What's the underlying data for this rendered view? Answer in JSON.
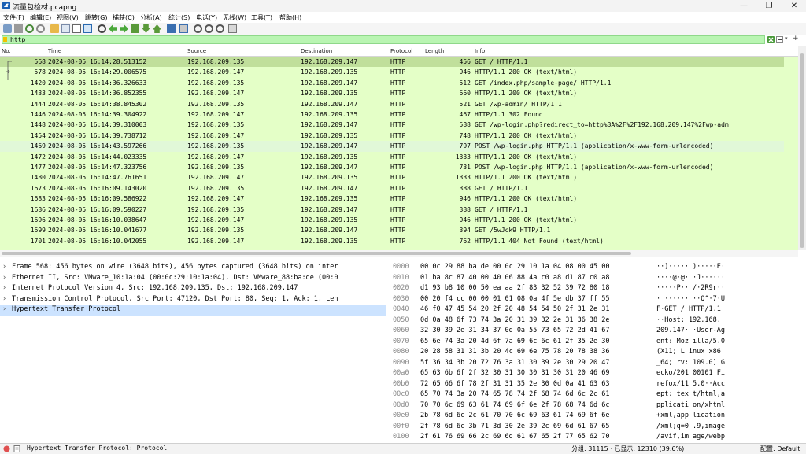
{
  "window": {
    "title": "流量包检材.pcapng"
  },
  "menu": [
    "文件(F)",
    "编辑(E)",
    "视图(V)",
    "跳转(G)",
    "捕获(C)",
    "分析(A)",
    "统计(S)",
    "电话(Y)",
    "无线(W)",
    "工具(T)",
    "帮助(H)"
  ],
  "filter": {
    "value": "http"
  },
  "packet_list": {
    "columns": [
      "No.",
      "Time",
      "Source",
      "Destination",
      "Protocol",
      "Length",
      "Info"
    ],
    "rows": [
      {
        "no": "568",
        "time": "2024-08-05 16:14:28.513152",
        "src": "192.168.209.135",
        "dst": "192.168.209.147",
        "proto": "HTTP",
        "len": "456",
        "info": "GET / HTTP/1.1"
      },
      {
        "no": "578",
        "time": "2024-08-05 16:14:29.006575",
        "src": "192.168.209.147",
        "dst": "192.168.209.135",
        "proto": "HTTP",
        "len": "946",
        "info": "HTTP/1.1 200 OK  (text/html)"
      },
      {
        "no": "1420",
        "time": "2024-08-05 16:14:36.326633",
        "src": "192.168.209.135",
        "dst": "192.168.209.147",
        "proto": "HTTP",
        "len": "512",
        "info": "GET /index.php/sample-page/ HTTP/1.1"
      },
      {
        "no": "1433",
        "time": "2024-08-05 16:14:36.852355",
        "src": "192.168.209.147",
        "dst": "192.168.209.135",
        "proto": "HTTP",
        "len": "660",
        "info": "HTTP/1.1 200 OK  (text/html)"
      },
      {
        "no": "1444",
        "time": "2024-08-05 16:14:38.845302",
        "src": "192.168.209.135",
        "dst": "192.168.209.147",
        "proto": "HTTP",
        "len": "521",
        "info": "GET /wp-admin/ HTTP/1.1"
      },
      {
        "no": "1446",
        "time": "2024-08-05 16:14:39.304922",
        "src": "192.168.209.147",
        "dst": "192.168.209.135",
        "proto": "HTTP",
        "len": "467",
        "info": "HTTP/1.1 302 Found"
      },
      {
        "no": "1448",
        "time": "2024-08-05 16:14:39.310003",
        "src": "192.168.209.135",
        "dst": "192.168.209.147",
        "proto": "HTTP",
        "len": "588",
        "info": "GET /wp-login.php?redirect_to=http%3A%2F%2F192.168.209.147%2Fwp-adm"
      },
      {
        "no": "1454",
        "time": "2024-08-05 16:14:39.738712",
        "src": "192.168.209.147",
        "dst": "192.168.209.135",
        "proto": "HTTP",
        "len": "748",
        "info": "HTTP/1.1 200 OK  (text/html)"
      },
      {
        "no": "1469",
        "time": "2024-08-05 16:14:43.597266",
        "src": "192.168.209.135",
        "dst": "192.168.209.147",
        "proto": "HTTP",
        "len": "797",
        "info": "POST /wp-login.php HTTP/1.1  (application/x-www-form-urlencoded)"
      },
      {
        "no": "1472",
        "time": "2024-08-05 16:14:44.023335",
        "src": "192.168.209.147",
        "dst": "192.168.209.135",
        "proto": "HTTP",
        "len": "1333",
        "info": "HTTP/1.1 200 OK  (text/html)"
      },
      {
        "no": "1477",
        "time": "2024-08-05 16:14:47.323756",
        "src": "192.168.209.135",
        "dst": "192.168.209.147",
        "proto": "HTTP",
        "len": "731",
        "info": "POST /wp-login.php HTTP/1.1  (application/x-www-form-urlencoded)"
      },
      {
        "no": "1480",
        "time": "2024-08-05 16:14:47.761651",
        "src": "192.168.209.147",
        "dst": "192.168.209.135",
        "proto": "HTTP",
        "len": "1333",
        "info": "HTTP/1.1 200 OK  (text/html)"
      },
      {
        "no": "1673",
        "time": "2024-08-05 16:16:09.143020",
        "src": "192.168.209.135",
        "dst": "192.168.209.147",
        "proto": "HTTP",
        "len": "388",
        "info": "GET / HTTP/1.1"
      },
      {
        "no": "1683",
        "time": "2024-08-05 16:16:09.586922",
        "src": "192.168.209.147",
        "dst": "192.168.209.135",
        "proto": "HTTP",
        "len": "946",
        "info": "HTTP/1.1 200 OK  (text/html)"
      },
      {
        "no": "1686",
        "time": "2024-08-05 16:16:09.590227",
        "src": "192.168.209.135",
        "dst": "192.168.209.147",
        "proto": "HTTP",
        "len": "388",
        "info": "GET / HTTP/1.1"
      },
      {
        "no": "1696",
        "time": "2024-08-05 16:16:10.038647",
        "src": "192.168.209.147",
        "dst": "192.168.209.135",
        "proto": "HTTP",
        "len": "946",
        "info": "HTTP/1.1 200 OK  (text/html)"
      },
      {
        "no": "1699",
        "time": "2024-08-05 16:16:10.041677",
        "src": "192.168.209.135",
        "dst": "192.168.209.147",
        "proto": "HTTP",
        "len": "394",
        "info": "GET /5wJck9 HTTP/1.1"
      },
      {
        "no": "1701",
        "time": "2024-08-05 16:16:10.042055",
        "src": "192.168.209.147",
        "dst": "192.168.209.135",
        "proto": "HTTP",
        "len": "762",
        "info": "HTTP/1.1 404 Not Found  (text/html)"
      }
    ]
  },
  "details": [
    "Frame 568: 456 bytes on wire (3648 bits), 456 bytes captured (3648 bits) on inter",
    "Ethernet II, Src: VMware_10:1a:04 (00:0c:29:10:1a:04), Dst: VMware_88:ba:de (00:0",
    "Internet Protocol Version 4, Src: 192.168.209.135, Dst: 192.168.209.147",
    "Transmission Control Protocol, Src Port: 47120, Dst Port: 80, Seq: 1, Ack: 1, Len",
    "Hypertext Transfer Protocol"
  ],
  "bytes": [
    {
      "off": "0000",
      "hex": "00 0c 29 88 ba de 00 0c  29 10 1a 04 08 00 45 00",
      "asc": "··)····· )·····E·"
    },
    {
      "off": "0010",
      "hex": "01 ba 8c 87 40 00 40 06  88 4a c0 a8 d1 87 c0 a8",
      "asc": "····@·@· ·J······"
    },
    {
      "off": "0020",
      "hex": "d1 93 b8 10 00 50 ea aa  2f 83 32 52 39 72 80 18",
      "asc": "·····P·· /·2R9r··"
    },
    {
      "off": "0030",
      "hex": "00 20 f4 cc 00 00 01 01  08 0a 4f 5e db 37 ff 55",
      "asc": "· ······ ··O^·7·U"
    },
    {
      "off": "0040",
      "hex": "46 f0 47 45 54 20 2f 20  48 54 54 50 2f 31 2e 31",
      "asc": "F·GET /  HTTP/1.1"
    },
    {
      "off": "0050",
      "hex": "0d 0a 48 6f 73 74 3a 20  31 39 32 2e 31 36 38 2e",
      "asc": "··Host:  192.168."
    },
    {
      "off": "0060",
      "hex": "32 30 39 2e 31 34 37 0d  0a 55 73 65 72 2d 41 67",
      "asc": "209.147· ·User-Ag"
    },
    {
      "off": "0070",
      "hex": "65 6e 74 3a 20 4d 6f 7a  69 6c 6c 61 2f 35 2e 30",
      "asc": "ent: Moz illa/5.0"
    },
    {
      "off": "0080",
      "hex": "20 28 58 31 31 3b 20 4c  69 6e 75 78 20 78 38 36",
      "asc": " (X11; L inux x86"
    },
    {
      "off": "0090",
      "hex": "5f 36 34 3b 20 72 76 3a  31 30 39 2e 30 29 20 47",
      "asc": "_64; rv: 109.0) G"
    },
    {
      "off": "00a0",
      "hex": "65 63 6b 6f 2f 32 30 31  30 30 31 30 31 20 46 69",
      "asc": "ecko/201 00101 Fi"
    },
    {
      "off": "00b0",
      "hex": "72 65 66 6f 78 2f 31 31  35 2e 30 0d 0a 41 63 63",
      "asc": "refox/11 5.0··Acc"
    },
    {
      "off": "00c0",
      "hex": "65 70 74 3a 20 74 65 78  74 2f 68 74 6d 6c 2c 61",
      "asc": "ept: tex t/html,a"
    },
    {
      "off": "00d0",
      "hex": "70 70 6c 69 63 61 74 69  6f 6e 2f 78 68 74 6d 6c",
      "asc": "pplicati on/xhtml"
    },
    {
      "off": "00e0",
      "hex": "2b 78 6d 6c 2c 61 70 70  6c 69 63 61 74 69 6f 6e",
      "asc": "+xml,app lication"
    },
    {
      "off": "00f0",
      "hex": "2f 78 6d 6c 3b 71 3d 30  2e 39 2c 69 6d 61 67 65",
      "asc": "/xml;q=0 .9,image"
    },
    {
      "off": "0100",
      "hex": "2f 61 76 69 66 2c 69 6d  61 67 65 2f 77 65 62 70",
      "asc": "/avif,im age/webp"
    },
    {
      "off": "0110",
      "hex": "2c 2a 2f 2a 3b 71 3d 30  2e 38 0d 0a 41 63 63 65",
      "asc": ",*/*;q=0 .8··Acce"
    }
  ],
  "status": {
    "left": "Hypertext Transfer Protocol: Protocol",
    "packets": "分组: 31115 · 已显示: 12310 (39.6%)",
    "profile": "配置: Default"
  },
  "colors": {
    "row_bg": "#e4ffc7",
    "row_selected": "#c0df9b",
    "filter_bg": "#b9f5b2",
    "detail_selected": "#cce3ff"
  }
}
